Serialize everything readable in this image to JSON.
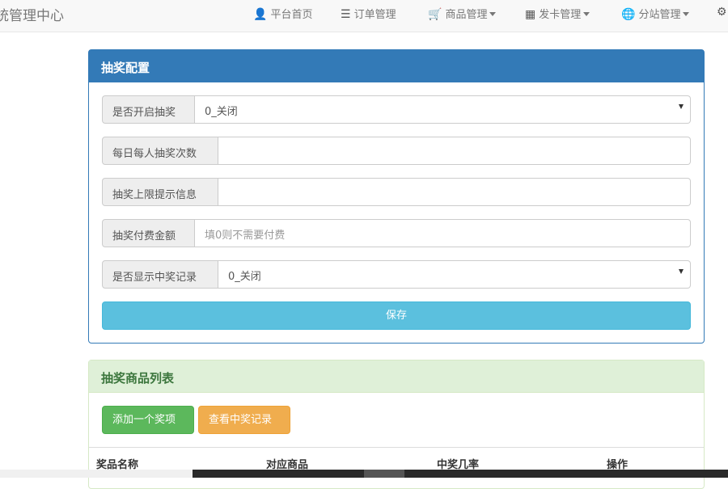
{
  "navbar": {
    "brand": "统管理中心",
    "items": [
      {
        "label": "平台首页",
        "icon": "user-icon",
        "glyph": "👤"
      },
      {
        "label": "订单管理",
        "icon": "list-icon",
        "glyph": "☰"
      },
      {
        "label": "商品管理",
        "icon": "cart-icon",
        "glyph": "🛒"
      },
      {
        "label": "发卡管理",
        "icon": "grid-icon",
        "glyph": "▦"
      },
      {
        "label": "分站管理",
        "icon": "globe-icon",
        "glyph": "🌐"
      }
    ],
    "gear_glyph": "⚙"
  },
  "config_panel": {
    "title": "抽奖配置",
    "fields": [
      {
        "label": "是否开启抽奖",
        "type": "select",
        "value": "0_关闭"
      },
      {
        "label": "每日每人抽奖次数",
        "type": "text",
        "value": ""
      },
      {
        "label": "抽奖上限提示信息",
        "type": "text",
        "value": ""
      },
      {
        "label": "抽奖付费金额",
        "type": "text",
        "placeholder": "填0则不需要付费"
      },
      {
        "label": "是否显示中奖记录",
        "type": "select",
        "value": "0_关闭"
      }
    ],
    "save_label": "保存"
  },
  "prize_panel": {
    "title": "抽奖商品列表",
    "add_label": "添加一个奖项",
    "records_label": "查看中奖记录",
    "columns": [
      "奖品名称",
      "对应商品",
      "中奖几率",
      "操作"
    ]
  },
  "colors": {
    "primary": "#337ab7",
    "info": "#5bc0de",
    "success": "#5cb85c",
    "warning": "#f0ad4e"
  }
}
